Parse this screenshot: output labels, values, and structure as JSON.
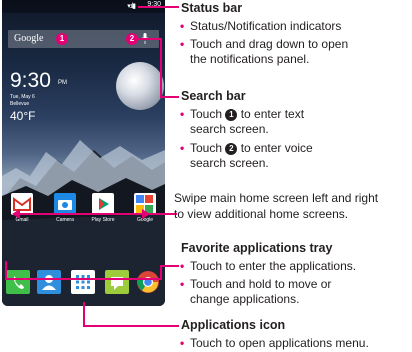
{
  "phone": {
    "status_time": "9:30",
    "signal": "▾.ıl▮",
    "search_logo": "Google",
    "search_badge_1": "1",
    "search_badge_2": "2",
    "clock": "9:30",
    "clock_ampm": "PM",
    "date": "Tue, May 6",
    "place": "Bellevue",
    "temperature": "40°F",
    "apps": [
      "Gmail",
      "Camera",
      "Play Store",
      "Google"
    ],
    "tray_icons": [
      "phone-icon",
      "contacts-icon",
      "apps-grid-icon",
      "messaging-icon",
      "chrome-icon"
    ]
  },
  "callouts": {
    "status_bar": {
      "title": "Status bar",
      "bullets": [
        "Status/Notification indicators",
        "Touch and drag down to open",
        "the notifications panel."
      ]
    },
    "search_bar": {
      "title": "Search bar",
      "b1_pre": "Touch ",
      "b1_badge": "1",
      "b1_post": " to enter text",
      "b1_line2": "search screen.",
      "b2_pre": "Touch ",
      "b2_badge": "2",
      "b2_post": " to enter voice",
      "b2_line2": "search screen."
    },
    "swipe": {
      "line1": "Swipe main home screen left and right",
      "line2": "to view additional home screens."
    },
    "favorites": {
      "title": "Favorite applications tray",
      "b1": "Touch to enter the applications.",
      "b2": "Touch and hold to move or",
      "b2_line2": "change applications."
    },
    "applications": {
      "title": "Applications icon",
      "b1": "Touch to open applications menu."
    }
  },
  "colors": {
    "accent": "#e20074",
    "text": "#231f20"
  }
}
